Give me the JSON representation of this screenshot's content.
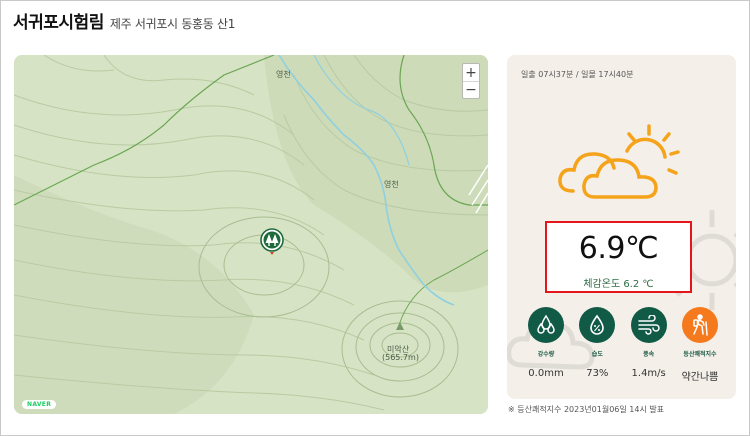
{
  "header": {
    "title": "서귀포시험림",
    "address": "제주 서귀포시 동홍동 산1"
  },
  "map": {
    "labels": {
      "stream_top": "영천",
      "stream_mid": "영천",
      "peak_name": "미악산",
      "peak_elevation": "(565.7m)"
    },
    "zoom_in": "+",
    "zoom_out": "−",
    "provider_logo": "NAVER",
    "marker_icon": "forest-tree-icon"
  },
  "weather": {
    "sun_times": "일출 07시37분 / 일몰 17시40분",
    "condition_icon": "partly-cloudy-icon",
    "temperature": "6.9℃",
    "feels_like": "체감온도 6.2 ℃",
    "metrics": [
      {
        "icon": "rain-drops-icon",
        "label": "강수량",
        "value": "0.0mm"
      },
      {
        "icon": "humidity-drop-icon",
        "label": "습도",
        "value": "73%"
      },
      {
        "icon": "wind-icon",
        "label": "풍속",
        "value": "1.4m/s"
      },
      {
        "icon": "hiker-icon",
        "label": "등산쾌적지수",
        "value": "약간나쁨"
      }
    ],
    "colors": {
      "accent": "#115a46",
      "hiking": "#f47a1d",
      "highlight": "#e4161b",
      "sun": "#f5a31a"
    }
  },
  "footnote": "※ 등산쾌적지수 2023년01월06일 14시 발표"
}
